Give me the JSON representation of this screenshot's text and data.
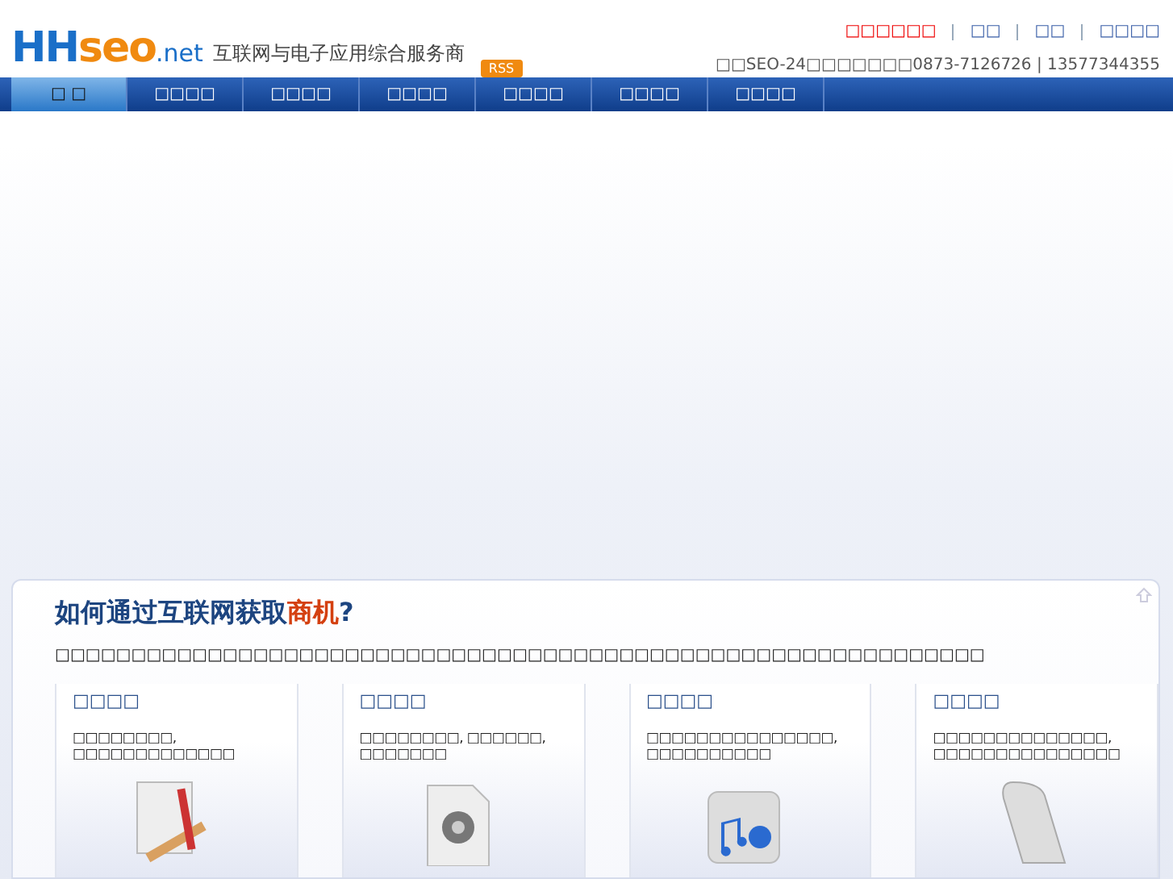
{
  "header": {
    "logo": {
      "main": "HHseo",
      "suffix": ".net"
    },
    "tagline": "互联网与电子应用综合服务商",
    "rss": "RSS",
    "links": [
      {
        "label": "□□□□□□",
        "highlight": true
      },
      {
        "label": "□□",
        "highlight": false
      },
      {
        "label": "□□",
        "highlight": false
      },
      {
        "label": "□□□□",
        "highlight": false
      }
    ],
    "contact": "□□SEO-24□□□□□□□0873-7126726 | 13577344355"
  },
  "nav": [
    {
      "label": "□ □",
      "selected": true
    },
    {
      "label": "□□□□",
      "selected": false
    },
    {
      "label": "□□□□",
      "selected": false
    },
    {
      "label": "□□□□",
      "selected": false
    },
    {
      "label": "□□□□",
      "selected": false
    },
    {
      "label": "□□□□",
      "selected": false
    },
    {
      "label": "□□□□",
      "selected": false
    }
  ],
  "panel": {
    "title": "如何通过互联网获取**商机**?",
    "intro": "□□□□□□□□□□□□□□□□□□□□□□□□□□□□□□□□□□□□□□□□□□□□□□□□□□□□□□□□□□□□□",
    "cards": [
      {
        "title": "□□□□",
        "text": "□□□□□□□□, □□□□□□□□□□□□□",
        "kind": "tools"
      },
      {
        "title": "□□□□",
        "text": "□□□□□□□□, □□□□□□, □□□□□□□",
        "kind": "audio"
      },
      {
        "title": "□□□□",
        "text": "□□□□□□□□□□□□□□□, □□□□□□□□□□",
        "kind": "blocks"
      },
      {
        "title": "□□□□",
        "text": "□□□□□□□□□□□□□□, □□□□□□□□□□□□□□□",
        "kind": "scroll"
      }
    ]
  }
}
